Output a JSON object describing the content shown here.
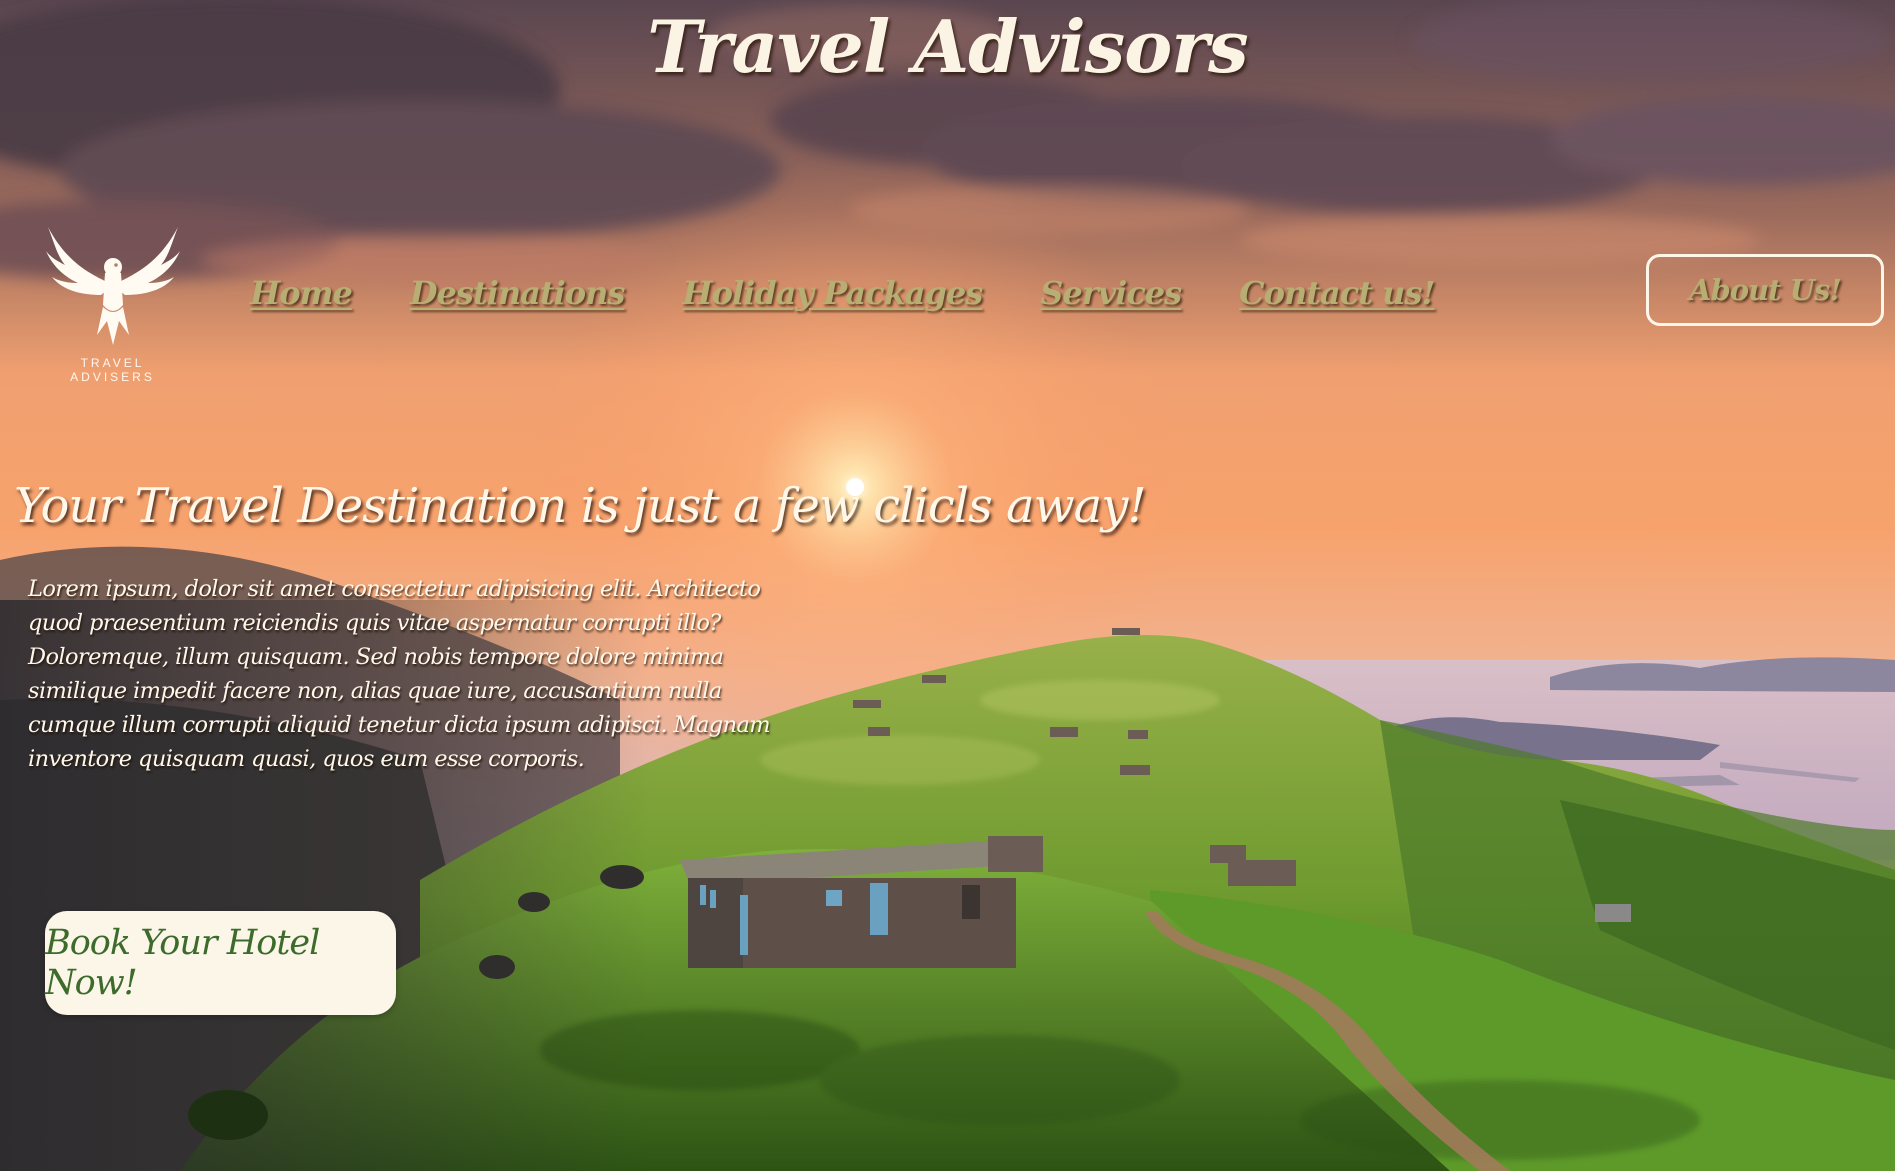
{
  "site": {
    "title": "Travel Advisors"
  },
  "logo": {
    "icon": "eagle-icon",
    "line1": "TRAVEL",
    "line2": "ADVISERS"
  },
  "nav": {
    "items": [
      {
        "label": "Home"
      },
      {
        "label": "Destinations"
      },
      {
        "label": "Holiday Packages"
      },
      {
        "label": "Services"
      },
      {
        "label": "Contact us!"
      }
    ],
    "about_label": "About Us!"
  },
  "hero": {
    "heading": "Your Travel Destination is just a few clicls away!",
    "paragraph": "Lorem ipsum, dolor sit amet consectetur adipisicing elit. Architecto quod praesentium reiciendis quis vitae aspernatur corrupti illo? Doloremque, illum quisquam. Sed nobis tempore dolore minima similique impedit facere non, alias quae iure, accusantium nulla cumque illum corrupti aliquid tenetur dicta ipsum adipisci. Magnam inventore quisquam quasi, quos eum esse corporis.",
    "cta_label": "Book Your Hotel Now!"
  },
  "colors": {
    "nav_text": "#b8ad73",
    "cta_text": "#3c6b2c",
    "cta_background": "#fbf6e8",
    "heading_text": "#fff8ea"
  }
}
